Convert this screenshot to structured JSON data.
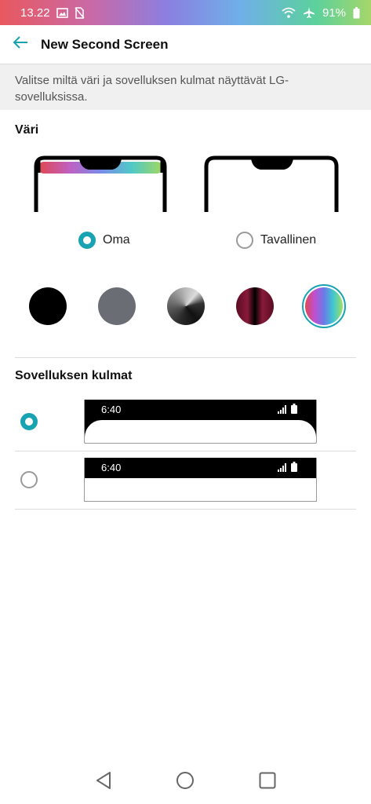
{
  "status_bar": {
    "time": "13.22",
    "battery": "91%",
    "icons": [
      "image-icon",
      "no-sim-icon",
      "wifi-icon",
      "airplane-icon",
      "battery-icon"
    ]
  },
  "app_bar": {
    "title": "New Second Screen",
    "back_icon": "back-arrow-icon"
  },
  "description": "Valitse miltä väri ja sovelluksen kulmat näyttävät LG-sovelluksissa.",
  "color_section": {
    "title": "Väri",
    "options": [
      {
        "label": "Oma",
        "selected": true
      },
      {
        "label": "Tavallinen",
        "selected": false
      }
    ],
    "swatches": [
      {
        "name": "black",
        "selected": false
      },
      {
        "name": "gray",
        "selected": false
      },
      {
        "name": "gray-gradient",
        "selected": false
      },
      {
        "name": "burgundy",
        "selected": false
      },
      {
        "name": "rainbow",
        "selected": true
      }
    ]
  },
  "corners_section": {
    "title": "Sovelluksen kulmat",
    "options": [
      {
        "time": "6:40",
        "style": "rounded",
        "selected": true
      },
      {
        "time": "6:40",
        "style": "square",
        "selected": false
      }
    ]
  },
  "colors": {
    "accent": "#18a3b3"
  }
}
